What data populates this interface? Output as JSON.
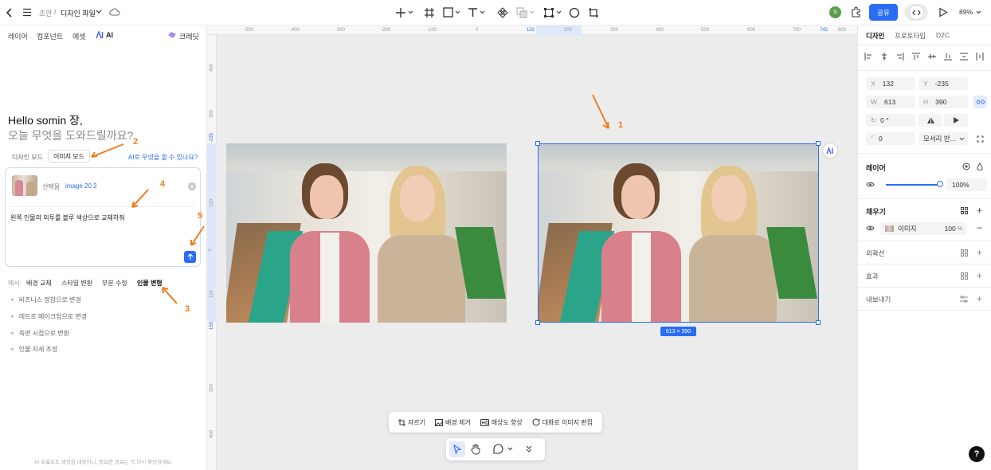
{
  "topbar": {
    "breadcrumb_parent": "초안",
    "breadcrumb_sep": "/",
    "file_name": "디자인 파일",
    "share_label": "공유",
    "zoom": "89%"
  },
  "left": {
    "tabs": [
      "레이어",
      "컴포넌트",
      "에셋",
      "AI"
    ],
    "credit_label": "크레딧",
    "greeting": "Hello somin 장,",
    "subgreeting": "오늘 무엇을 도와드릴까요?",
    "mode_design": "디자인 모드",
    "mode_image": "이미지 모드",
    "help_link": "AI로 무엇을 할 수 있나요?",
    "selected_label": "선택됨",
    "selected_name": "image 20 2",
    "prompt_text": "왼쪽 인물의 외투를 블루 색상으로 교체하줘",
    "examples_label": "예시:",
    "example_chips": [
      "배경 교체",
      "스타일 변환",
      "부분 수정",
      "인물 변형"
    ],
    "suggestions": [
      "비즈니스 정장으로 변경",
      "레트로 메이크업으로 변경",
      "측면 시점으로 변환",
      "인물 자세 조정"
    ],
    "footer_note": "AI 프롬프트 생성된 내용이니, 중요한 정보는 꼭 다시 확인하세요."
  },
  "annotations": [
    "1",
    "2",
    "3",
    "4",
    "5"
  ],
  "canvas": {
    "ruler_h": [
      "-500",
      "-400",
      "-300",
      "-200",
      "-100",
      "0",
      "132",
      "200",
      "300",
      "400",
      "500",
      "600",
      "700",
      "745",
      "800"
    ],
    "ruler_v": [
      "400",
      "300",
      "-235",
      "100",
      "0",
      "100",
      "155",
      "300",
      "400"
    ],
    "size_badge": "613 × 390",
    "tools": [
      "자르기",
      "배경 제거",
      "해상도 향상",
      "대화로 이미지 편집"
    ]
  },
  "right": {
    "tabs": [
      "디자인",
      "프로토타입",
      "D2C"
    ],
    "x_label": "X",
    "x": "132",
    "y_label": "Y",
    "y": "-235",
    "w_label": "W",
    "w": "613",
    "h_label": "H",
    "h": "390",
    "rotation": "0 °",
    "radius": "0",
    "blend_mode": "모서리 반...",
    "layer_title": "레이어",
    "opacity": "100%",
    "fill_title": "채우기",
    "fill_type": "이미지",
    "fill_opacity": "100",
    "fill_unit": "%",
    "stroke_title": "외곽선",
    "effect_title": "효과",
    "export_title": "내보내기"
  },
  "colors": {
    "accent": "#2a6df5",
    "annotation": "#f07c22",
    "canvas_bg": "#ececec"
  }
}
